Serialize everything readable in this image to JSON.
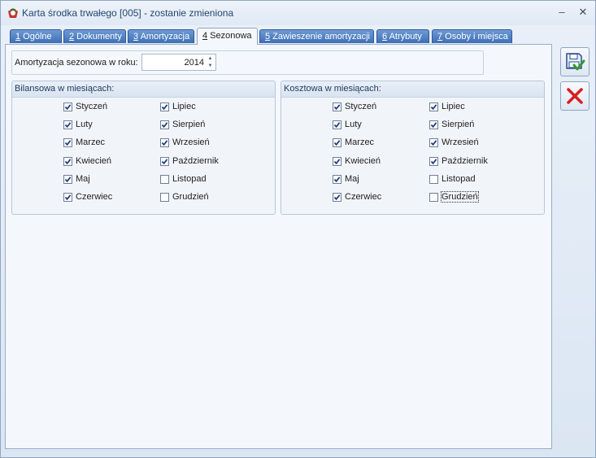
{
  "window": {
    "title": "Karta środka trwałego [005] - zostanie zmieniona",
    "minimize_glyph": "–",
    "close_glyph": "✕"
  },
  "tabs": [
    {
      "key": "1",
      "label": " Ogólne",
      "active": false
    },
    {
      "key": "2",
      "label": " Dokumenty",
      "active": false
    },
    {
      "key": "3",
      "label": " Amortyzacja",
      "active": false
    },
    {
      "key": "4",
      "label": " Sezonowa",
      "active": true
    },
    {
      "key": "5",
      "label": " Zawieszenie amortyzacji",
      "active": false
    },
    {
      "key": "6",
      "label": " Atrybuty",
      "active": false
    },
    {
      "key": "7",
      "label": " Osoby i miejsca",
      "active": false
    }
  ],
  "year": {
    "label": "Amortyzacja sezonowa w roku:",
    "value": "2014"
  },
  "groups": {
    "bilansowa": {
      "title": "Bilansowa w miesiącach:",
      "months": [
        {
          "label": "Styczeń",
          "checked": true
        },
        {
          "label": "Luty",
          "checked": true
        },
        {
          "label": "Marzec",
          "checked": true
        },
        {
          "label": "Kwiecień",
          "checked": true
        },
        {
          "label": "Maj",
          "checked": true
        },
        {
          "label": "Czerwiec",
          "checked": true
        },
        {
          "label": "Lipiec",
          "checked": true
        },
        {
          "label": "Sierpień",
          "checked": true
        },
        {
          "label": "Wrzesień",
          "checked": true
        },
        {
          "label": "Październik",
          "checked": true
        },
        {
          "label": "Listopad",
          "checked": false
        },
        {
          "label": "Grudzień",
          "checked": false
        }
      ]
    },
    "kosztowa": {
      "title": "Kosztowa w miesiącach:",
      "months": [
        {
          "label": "Styczeń",
          "checked": true
        },
        {
          "label": "Luty",
          "checked": true
        },
        {
          "label": "Marzec",
          "checked": true
        },
        {
          "label": "Kwiecień",
          "checked": true
        },
        {
          "label": "Maj",
          "checked": true
        },
        {
          "label": "Czerwiec",
          "checked": true
        },
        {
          "label": "Lipiec",
          "checked": true
        },
        {
          "label": "Sierpień",
          "checked": true
        },
        {
          "label": "Wrzesień",
          "checked": true
        },
        {
          "label": "Październik",
          "checked": true
        },
        {
          "label": "Listopad",
          "checked": false
        },
        {
          "label": "Grudzień",
          "checked": false
        }
      ]
    }
  },
  "actions": {
    "save_icon": "save-confirm-icon",
    "cancel_icon": "cancel-x-icon"
  },
  "colors": {
    "tab_active": "#3d6fb6",
    "check": "#1a3a7a",
    "cancel": "#d81e1e",
    "confirm": "#2f9a2f"
  }
}
